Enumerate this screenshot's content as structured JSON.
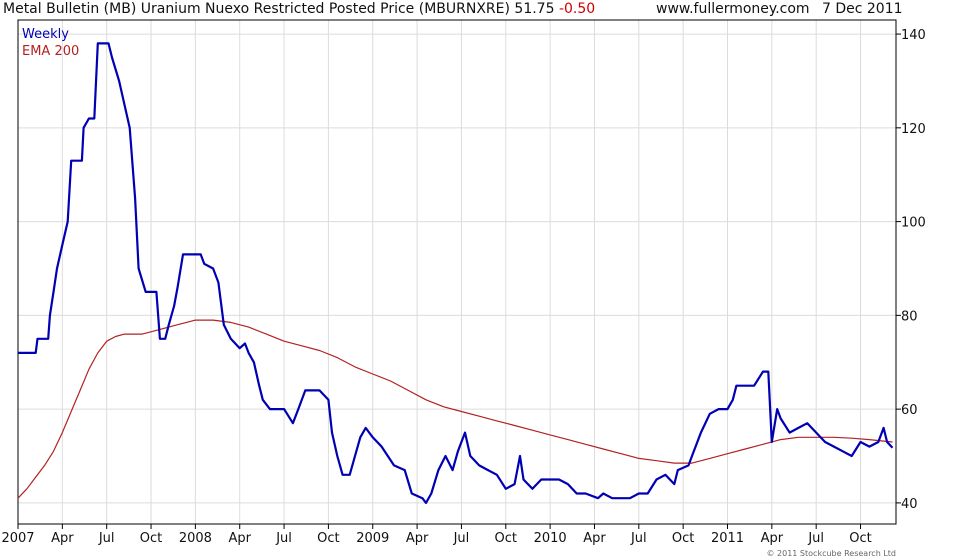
{
  "header": {
    "title": "Metal Bulletin (MB) Uranium Nuexo Restricted Posted Price (MBURNXRE)",
    "last_value": "51.75",
    "change": "-0.50",
    "source": "www.fullermoney.com",
    "date": "7 Dec 2011"
  },
  "copyright": "© 2011 Stockcube Research Ltd",
  "colors": {
    "price": "#0000b4",
    "ema": "#b22222",
    "grid": "#dcdcdc",
    "axis": "#000000"
  },
  "chart_data": {
    "type": "line",
    "title": "Metal Bulletin (MB) Uranium Nuexo Restricted Posted Price (MBURNXRE)",
    "xlabel": "",
    "ylabel": "",
    "xlim": [
      2007.0,
      2011.95
    ],
    "ylim": [
      35.5,
      143
    ],
    "y_ticks": [
      40,
      60,
      80,
      100,
      120,
      140
    ],
    "x_ticks": [
      {
        "label": "2007",
        "x": 2007.0
      },
      {
        "label": "Apr",
        "x": 2007.25
      },
      {
        "label": "Jul",
        "x": 2007.5
      },
      {
        "label": "Oct",
        "x": 2007.75
      },
      {
        "label": "2008",
        "x": 2008.0
      },
      {
        "label": "Apr",
        "x": 2008.25
      },
      {
        "label": "Jul",
        "x": 2008.5
      },
      {
        "label": "Oct",
        "x": 2008.75
      },
      {
        "label": "2009",
        "x": 2009.0
      },
      {
        "label": "Apr",
        "x": 2009.25
      },
      {
        "label": "Jul",
        "x": 2009.5
      },
      {
        "label": "Oct",
        "x": 2009.75
      },
      {
        "label": "2010",
        "x": 2010.0
      },
      {
        "label": "Apr",
        "x": 2010.25
      },
      {
        "label": "Jul",
        "x": 2010.5
      },
      {
        "label": "Oct",
        "x": 2010.75
      },
      {
        "label": "2011",
        "x": 2011.0
      },
      {
        "label": "Apr",
        "x": 2011.25
      },
      {
        "label": "Jul",
        "x": 2011.5
      },
      {
        "label": "Oct",
        "x": 2011.75
      }
    ],
    "grid": true,
    "y_axis_side": "right",
    "legend": "top-left",
    "series": [
      {
        "name": "Weekly",
        "points": [
          [
            2007.0,
            72
          ],
          [
            2007.1,
            72
          ],
          [
            2007.11,
            75
          ],
          [
            2007.17,
            75
          ],
          [
            2007.18,
            80
          ],
          [
            2007.2,
            85
          ],
          [
            2007.22,
            90
          ],
          [
            2007.25,
            95
          ],
          [
            2007.28,
            100
          ],
          [
            2007.3,
            113
          ],
          [
            2007.36,
            113
          ],
          [
            2007.37,
            120
          ],
          [
            2007.4,
            122
          ],
          [
            2007.43,
            122
          ],
          [
            2007.45,
            138
          ],
          [
            2007.51,
            138
          ],
          [
            2007.53,
            135
          ],
          [
            2007.57,
            130
          ],
          [
            2007.6,
            125
          ],
          [
            2007.63,
            120
          ],
          [
            2007.66,
            105
          ],
          [
            2007.68,
            90
          ],
          [
            2007.72,
            85
          ],
          [
            2007.78,
            85
          ],
          [
            2007.8,
            75
          ],
          [
            2007.83,
            75
          ],
          [
            2007.85,
            78
          ],
          [
            2007.88,
            82
          ],
          [
            2007.9,
            86
          ],
          [
            2007.93,
            93
          ],
          [
            2008.03,
            93
          ],
          [
            2008.05,
            91
          ],
          [
            2008.1,
            90
          ],
          [
            2008.13,
            87
          ],
          [
            2008.16,
            78
          ],
          [
            2008.2,
            75
          ],
          [
            2008.25,
            73
          ],
          [
            2008.28,
            74
          ],
          [
            2008.3,
            72
          ],
          [
            2008.33,
            70
          ],
          [
            2008.36,
            65
          ],
          [
            2008.38,
            62
          ],
          [
            2008.42,
            60
          ],
          [
            2008.5,
            60
          ],
          [
            2008.55,
            57
          ],
          [
            2008.58,
            60
          ],
          [
            2008.62,
            64
          ],
          [
            2008.7,
            64
          ],
          [
            2008.75,
            62
          ],
          [
            2008.77,
            55
          ],
          [
            2008.8,
            50
          ],
          [
            2008.83,
            46
          ],
          [
            2008.87,
            46
          ],
          [
            2008.9,
            50
          ],
          [
            2008.93,
            54
          ],
          [
            2008.96,
            56
          ],
          [
            2009.0,
            54
          ],
          [
            2009.05,
            52
          ],
          [
            2009.12,
            48
          ],
          [
            2009.18,
            47
          ],
          [
            2009.22,
            42
          ],
          [
            2009.28,
            41
          ],
          [
            2009.3,
            40
          ],
          [
            2009.33,
            42
          ],
          [
            2009.37,
            47
          ],
          [
            2009.41,
            50
          ],
          [
            2009.45,
            47
          ],
          [
            2009.48,
            51
          ],
          [
            2009.52,
            55
          ],
          [
            2009.55,
            50
          ],
          [
            2009.6,
            48
          ],
          [
            2009.65,
            47
          ],
          [
            2009.7,
            46
          ],
          [
            2009.75,
            43
          ],
          [
            2009.8,
            44
          ],
          [
            2009.83,
            50
          ],
          [
            2009.85,
            45
          ],
          [
            2009.9,
            43
          ],
          [
            2009.95,
            45
          ],
          [
            2010.05,
            45
          ],
          [
            2010.1,
            44
          ],
          [
            2010.15,
            42
          ],
          [
            2010.2,
            42
          ],
          [
            2010.27,
            41
          ],
          [
            2010.3,
            42
          ],
          [
            2010.35,
            41
          ],
          [
            2010.45,
            41
          ],
          [
            2010.5,
            42
          ],
          [
            2010.55,
            42
          ],
          [
            2010.6,
            45
          ],
          [
            2010.65,
            46
          ],
          [
            2010.7,
            44
          ],
          [
            2010.72,
            47
          ],
          [
            2010.78,
            48
          ],
          [
            2010.8,
            50
          ],
          [
            2010.85,
            55
          ],
          [
            2010.9,
            59
          ],
          [
            2010.95,
            60
          ],
          [
            2011.0,
            60
          ],
          [
            2011.03,
            62
          ],
          [
            2011.05,
            65
          ],
          [
            2011.15,
            65
          ],
          [
            2011.2,
            68
          ],
          [
            2011.23,
            68
          ],
          [
            2011.25,
            53
          ],
          [
            2011.28,
            60
          ],
          [
            2011.3,
            58
          ],
          [
            2011.35,
            55
          ],
          [
            2011.4,
            56
          ],
          [
            2011.45,
            57
          ],
          [
            2011.5,
            55
          ],
          [
            2011.55,
            53
          ],
          [
            2011.6,
            52
          ],
          [
            2011.65,
            51
          ],
          [
            2011.7,
            50
          ],
          [
            2011.75,
            53
          ],
          [
            2011.8,
            52
          ],
          [
            2011.85,
            53
          ],
          [
            2011.88,
            56
          ],
          [
            2011.9,
            53
          ],
          [
            2011.93,
            51.75
          ]
        ]
      },
      {
        "name": "EMA 200",
        "points": [
          [
            2007.0,
            41
          ],
          [
            2007.05,
            43
          ],
          [
            2007.1,
            45.5
          ],
          [
            2007.15,
            48
          ],
          [
            2007.2,
            51
          ],
          [
            2007.25,
            55
          ],
          [
            2007.3,
            59.5
          ],
          [
            2007.35,
            64
          ],
          [
            2007.4,
            68.5
          ],
          [
            2007.45,
            72
          ],
          [
            2007.5,
            74.5
          ],
          [
            2007.55,
            75.5
          ],
          [
            2007.6,
            76
          ],
          [
            2007.65,
            76
          ],
          [
            2007.7,
            76
          ],
          [
            2007.75,
            76.5
          ],
          [
            2007.8,
            77
          ],
          [
            2007.85,
            77.5
          ],
          [
            2007.9,
            78
          ],
          [
            2007.95,
            78.5
          ],
          [
            2008.0,
            79
          ],
          [
            2008.1,
            79
          ],
          [
            2008.2,
            78.5
          ],
          [
            2008.3,
            77.5
          ],
          [
            2008.4,
            76
          ],
          [
            2008.5,
            74.5
          ],
          [
            2008.6,
            73.5
          ],
          [
            2008.7,
            72.5
          ],
          [
            2008.8,
            71
          ],
          [
            2008.9,
            69
          ],
          [
            2009.0,
            67.5
          ],
          [
            2009.1,
            66
          ],
          [
            2009.2,
            64
          ],
          [
            2009.3,
            62
          ],
          [
            2009.4,
            60.5
          ],
          [
            2009.5,
            59.5
          ],
          [
            2009.6,
            58.5
          ],
          [
            2009.7,
            57.5
          ],
          [
            2009.8,
            56.5
          ],
          [
            2009.9,
            55.5
          ],
          [
            2010.0,
            54.5
          ],
          [
            2010.1,
            53.5
          ],
          [
            2010.2,
            52.5
          ],
          [
            2010.3,
            51.5
          ],
          [
            2010.4,
            50.5
          ],
          [
            2010.5,
            49.5
          ],
          [
            2010.6,
            49
          ],
          [
            2010.7,
            48.5
          ],
          [
            2010.8,
            48.5
          ],
          [
            2010.9,
            49.5
          ],
          [
            2011.0,
            50.5
          ],
          [
            2011.1,
            51.5
          ],
          [
            2011.2,
            52.5
          ],
          [
            2011.3,
            53.5
          ],
          [
            2011.4,
            54
          ],
          [
            2011.5,
            54
          ],
          [
            2011.6,
            54
          ],
          [
            2011.7,
            53.8
          ],
          [
            2011.8,
            53.5
          ],
          [
            2011.93,
            53
          ]
        ]
      }
    ]
  }
}
